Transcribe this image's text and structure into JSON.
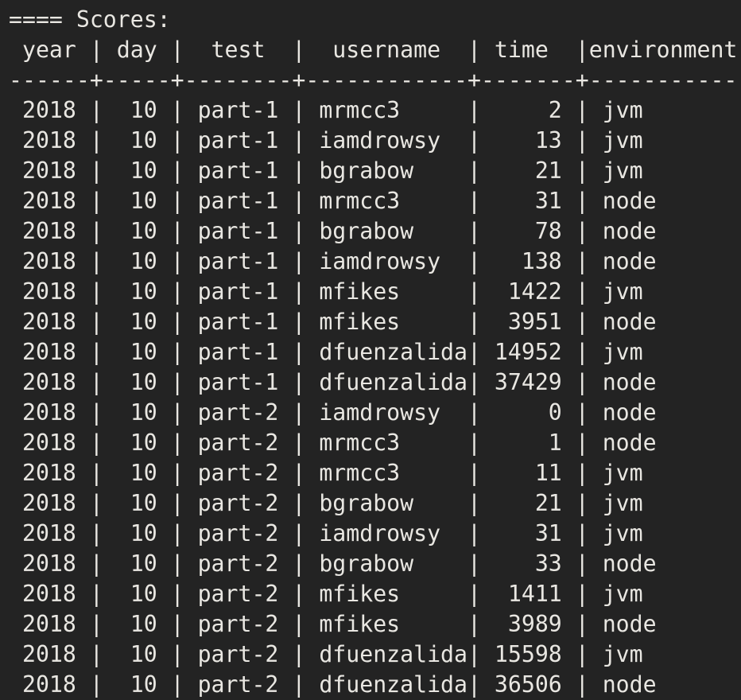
{
  "terminal": {
    "background_color": "#232323",
    "foreground_color": "#e9e7e2",
    "heading": "==== Scores:",
    "table": {
      "columns": [
        {
          "name": "year",
          "width": 6,
          "align": "right"
        },
        {
          "name": "day",
          "width": 5,
          "align": "right"
        },
        {
          "name": "test",
          "width": 8,
          "align": "center"
        },
        {
          "name": "username",
          "width": 12,
          "align": "left"
        },
        {
          "name": "time",
          "width": 7,
          "align": "right"
        },
        {
          "name": "environment",
          "width": 12,
          "align": "left"
        }
      ],
      "header_labels": [
        "year",
        "day",
        "test",
        "username",
        "time",
        "environment"
      ],
      "separator_segments": [
        "------",
        "-----",
        "--------",
        "------------",
        "-------",
        "------------"
      ],
      "separator_joint": "+",
      "column_separator": "|",
      "rows": [
        {
          "year": "2018",
          "day": "10",
          "test": "part-1",
          "username": "mrmcc3",
          "time": "2",
          "environment": "jvm"
        },
        {
          "year": "2018",
          "day": "10",
          "test": "part-1",
          "username": "iamdrowsy",
          "time": "13",
          "environment": "jvm"
        },
        {
          "year": "2018",
          "day": "10",
          "test": "part-1",
          "username": "bgrabow",
          "time": "21",
          "environment": "jvm"
        },
        {
          "year": "2018",
          "day": "10",
          "test": "part-1",
          "username": "mrmcc3",
          "time": "31",
          "environment": "node"
        },
        {
          "year": "2018",
          "day": "10",
          "test": "part-1",
          "username": "bgrabow",
          "time": "78",
          "environment": "node"
        },
        {
          "year": "2018",
          "day": "10",
          "test": "part-1",
          "username": "iamdrowsy",
          "time": "138",
          "environment": "node"
        },
        {
          "year": "2018",
          "day": "10",
          "test": "part-1",
          "username": "mfikes",
          "time": "1422",
          "environment": "jvm"
        },
        {
          "year": "2018",
          "day": "10",
          "test": "part-1",
          "username": "mfikes",
          "time": "3951",
          "environment": "node"
        },
        {
          "year": "2018",
          "day": "10",
          "test": "part-1",
          "username": "dfuenzalida",
          "time": "14952",
          "environment": "jvm"
        },
        {
          "year": "2018",
          "day": "10",
          "test": "part-1",
          "username": "dfuenzalida",
          "time": "37429",
          "environment": "node"
        },
        {
          "year": "2018",
          "day": "10",
          "test": "part-2",
          "username": "iamdrowsy",
          "time": "0",
          "environment": "node"
        },
        {
          "year": "2018",
          "day": "10",
          "test": "part-2",
          "username": "mrmcc3",
          "time": "1",
          "environment": "node"
        },
        {
          "year": "2018",
          "day": "10",
          "test": "part-2",
          "username": "mrmcc3",
          "time": "11",
          "environment": "jvm"
        },
        {
          "year": "2018",
          "day": "10",
          "test": "part-2",
          "username": "bgrabow",
          "time": "21",
          "environment": "jvm"
        },
        {
          "year": "2018",
          "day": "10",
          "test": "part-2",
          "username": "iamdrowsy",
          "time": "31",
          "environment": "jvm"
        },
        {
          "year": "2018",
          "day": "10",
          "test": "part-2",
          "username": "bgrabow",
          "time": "33",
          "environment": "node"
        },
        {
          "year": "2018",
          "day": "10",
          "test": "part-2",
          "username": "mfikes",
          "time": "1411",
          "environment": "jvm"
        },
        {
          "year": "2018",
          "day": "10",
          "test": "part-2",
          "username": "mfikes",
          "time": "3989",
          "environment": "node"
        },
        {
          "year": "2018",
          "day": "10",
          "test": "part-2",
          "username": "dfuenzalida",
          "time": "15598",
          "environment": "jvm"
        },
        {
          "year": "2018",
          "day": "10",
          "test": "part-2",
          "username": "dfuenzalida",
          "time": "36506",
          "environment": "node"
        }
      ]
    }
  }
}
